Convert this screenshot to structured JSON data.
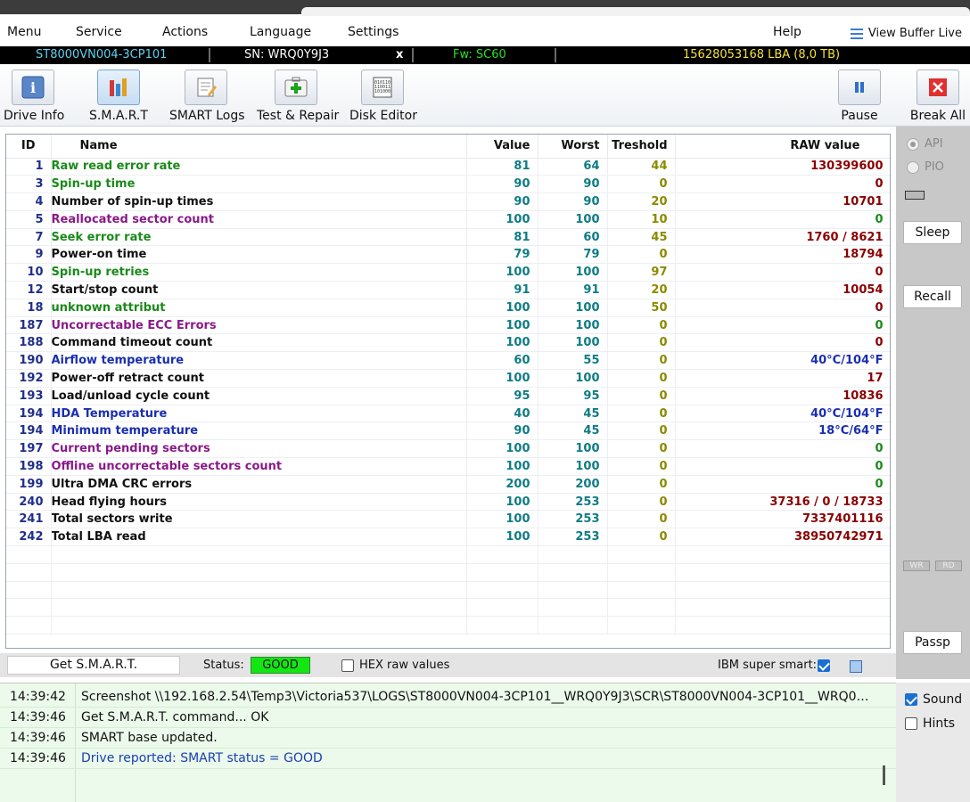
{
  "menu": {
    "items": [
      "Menu",
      "Service",
      "Actions",
      "Language",
      "Settings",
      "Help"
    ],
    "view_buffer": "View Buffer Live"
  },
  "drive": {
    "model": "ST8000VN004-3CP101",
    "serial": "SN: WRQ0Y9J3",
    "close": "x",
    "firmware": "Fw: SC60",
    "lba": "15628053168 LBA (8,0 TB)"
  },
  "toolbar": {
    "drive_info": "Drive Info",
    "smart": "S.M.A.R.T",
    "smart_logs": "SMART Logs",
    "test_repair": "Test & Repair",
    "disk_editor": "Disk Editor",
    "pause": "Pause",
    "break_all": "Break All"
  },
  "table": {
    "headers": [
      "ID",
      "Name",
      "Value",
      "Worst",
      "Treshold",
      "RAW value"
    ],
    "rows": [
      {
        "id": "1",
        "name": "Raw read error rate",
        "value": "81",
        "worst": "64",
        "threshold": "44",
        "raw": "130399600",
        "name_color": "green",
        "raw_color": "red"
      },
      {
        "id": "3",
        "name": "Spin-up time",
        "value": "90",
        "worst": "90",
        "threshold": "0",
        "raw": "0",
        "name_color": "green",
        "raw_color": "red"
      },
      {
        "id": "4",
        "name": "Number of spin-up times",
        "value": "90",
        "worst": "90",
        "threshold": "20",
        "raw": "10701",
        "name_color": "black",
        "raw_color": "red"
      },
      {
        "id": "5",
        "name": "Reallocated sector count",
        "value": "100",
        "worst": "100",
        "threshold": "10",
        "raw": "0",
        "name_color": "purple",
        "raw_color": "green"
      },
      {
        "id": "7",
        "name": "Seek error rate",
        "value": "81",
        "worst": "60",
        "threshold": "45",
        "raw": "1760 / 8621",
        "name_color": "green",
        "raw_color": "red"
      },
      {
        "id": "9",
        "name": "Power-on time",
        "value": "79",
        "worst": "79",
        "threshold": "0",
        "raw": "18794",
        "name_color": "black",
        "raw_color": "red"
      },
      {
        "id": "10",
        "name": "Spin-up retries",
        "value": "100",
        "worst": "100",
        "threshold": "97",
        "raw": "0",
        "name_color": "green",
        "raw_color": "red"
      },
      {
        "id": "12",
        "name": "Start/stop count",
        "value": "91",
        "worst": "91",
        "threshold": "20",
        "raw": "10054",
        "name_color": "black",
        "raw_color": "red"
      },
      {
        "id": "18",
        "name": "unknown attribut",
        "value": "100",
        "worst": "100",
        "threshold": "50",
        "raw": "0",
        "name_color": "green",
        "raw_color": "red"
      },
      {
        "id": "187",
        "name": "Uncorrectable ECC Errors",
        "value": "100",
        "worst": "100",
        "threshold": "0",
        "raw": "0",
        "name_color": "purple",
        "raw_color": "green"
      },
      {
        "id": "188",
        "name": "Command timeout count",
        "value": "100",
        "worst": "100",
        "threshold": "0",
        "raw": "0",
        "name_color": "black",
        "raw_color": "red"
      },
      {
        "id": "190",
        "name": "Airflow temperature",
        "value": "60",
        "worst": "55",
        "threshold": "0",
        "raw": "40°C/104°F",
        "name_color": "blue",
        "raw_color": "blue"
      },
      {
        "id": "192",
        "name": "Power-off retract count",
        "value": "100",
        "worst": "100",
        "threshold": "0",
        "raw": "17",
        "name_color": "black",
        "raw_color": "red"
      },
      {
        "id": "193",
        "name": "Load/unload cycle count",
        "value": "95",
        "worst": "95",
        "threshold": "0",
        "raw": "10836",
        "name_color": "black",
        "raw_color": "red"
      },
      {
        "id": "194",
        "name": "HDA Temperature",
        "value": "40",
        "worst": "45",
        "threshold": "0",
        "raw": "40°C/104°F",
        "name_color": "blue",
        "raw_color": "blue"
      },
      {
        "id": "194",
        "name": "Minimum temperature",
        "value": "90",
        "worst": "45",
        "threshold": "0",
        "raw": "18°C/64°F",
        "name_color": "blue",
        "raw_color": "blue"
      },
      {
        "id": "197",
        "name": "Current pending sectors",
        "value": "100",
        "worst": "100",
        "threshold": "0",
        "raw": "0",
        "name_color": "purple",
        "raw_color": "green"
      },
      {
        "id": "198",
        "name": "Offline uncorrectable sectors count",
        "value": "100",
        "worst": "100",
        "threshold": "0",
        "raw": "0",
        "name_color": "purple",
        "raw_color": "green"
      },
      {
        "id": "199",
        "name": "Ultra DMA CRC errors",
        "value": "200",
        "worst": "200",
        "threshold": "0",
        "raw": "0",
        "name_color": "black",
        "raw_color": "green"
      },
      {
        "id": "240",
        "name": "Head flying hours",
        "value": "100",
        "worst": "253",
        "threshold": "0",
        "raw": "37316 / 0 / 18733",
        "name_color": "black",
        "raw_color": "red"
      },
      {
        "id": "241",
        "name": "Total sectors write",
        "value": "100",
        "worst": "253",
        "threshold": "0",
        "raw": "7337401116",
        "name_color": "black",
        "raw_color": "red"
      },
      {
        "id": "242",
        "name": "Total LBA read",
        "value": "100",
        "worst": "253",
        "threshold": "0",
        "raw": "38950742971",
        "name_color": "black",
        "raw_color": "red"
      }
    ],
    "empty_rows": 5
  },
  "side": {
    "api": "API",
    "pio": "PIO",
    "sleep": "Sleep",
    "recall": "Recall",
    "wr": "WR",
    "rd": "RD",
    "passp": "Passp"
  },
  "status": {
    "get_smart": "Get S.M.A.R.T.",
    "status_label": "Status:",
    "status_value": "GOOD",
    "hex_label": "HEX raw values",
    "ibm_label": "IBM super smart:"
  },
  "log": [
    {
      "time": "14:39:42",
      "msg": "Screenshot \\\\192.168.2.54\\Temp3\\Victoria537\\LOGS\\ST8000VN004-3CP101__WRQ0Y9J3\\SCR\\ST8000VN004-3CP101__WRQ0Y9J3_...",
      "color": "black"
    },
    {
      "time": "14:39:46",
      "msg": "Get S.M.A.R.T. command... OK",
      "color": "black"
    },
    {
      "time": "14:39:46",
      "msg": "SMART base updated.",
      "color": "black"
    },
    {
      "time": "14:39:46",
      "msg": "Drive reported: SMART status = GOOD",
      "color": "blue"
    }
  ],
  "options": {
    "sound": "Sound",
    "hints": "Hints"
  },
  "colors": {
    "status_good": "#14e614",
    "name_green": "#1a8a1a",
    "name_purple": "#8a1a8a",
    "name_blue": "#1a2fb0",
    "raw_red": "#8b0000"
  }
}
